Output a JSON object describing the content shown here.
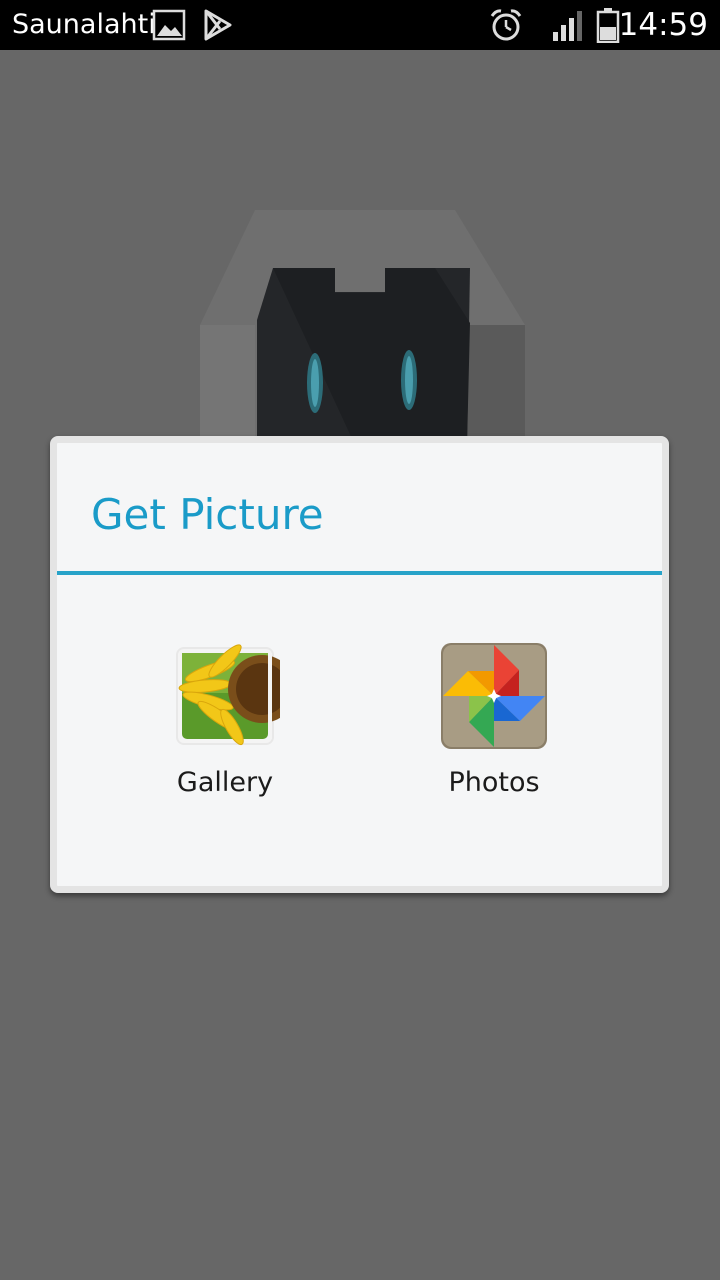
{
  "status_bar": {
    "carrier": "Saunalahti",
    "time": "14:59",
    "icons": [
      "image-notification-icon",
      "play-store-icon",
      "alarm-icon",
      "signal-icon",
      "battery-icon"
    ]
  },
  "dialog": {
    "title": "Get Picture",
    "accent_color": "#1a9bc8",
    "options": [
      {
        "label": "Gallery",
        "icon": "gallery-sunflower-icon"
      },
      {
        "label": "Photos",
        "icon": "google-photos-pinwheel-icon"
      }
    ]
  }
}
